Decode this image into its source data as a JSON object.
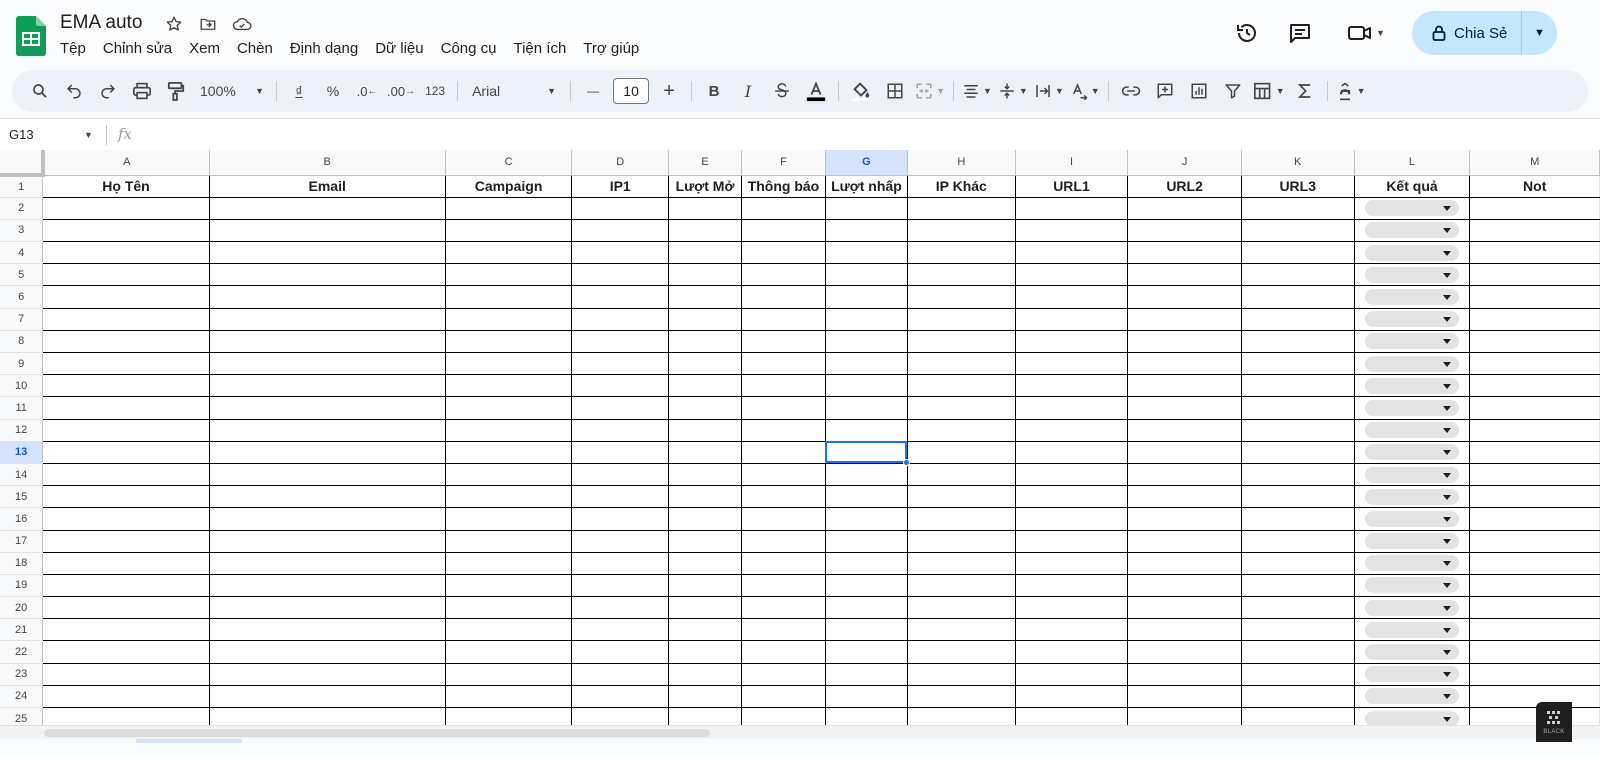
{
  "doc": {
    "title": "EMA auto"
  },
  "menu": [
    "Tệp",
    "Chỉnh sửa",
    "Xem",
    "Chèn",
    "Định dạng",
    "Dữ liệu",
    "Công cụ",
    "Tiện ích",
    "Trợ giúp"
  ],
  "share": {
    "label": "Chia Sẻ"
  },
  "toolbar": {
    "zoom": "100%",
    "currency": "₫",
    "percent": "%",
    "dec_decrease": ".0",
    "dec_increase": ".00",
    "number_format": "123",
    "font": "Arial",
    "font_size": "10",
    "minus": "—",
    "plus": "+",
    "bold": "B",
    "italic": "I"
  },
  "formula_bar": {
    "name_box": "G13",
    "fx": "fx",
    "value": ""
  },
  "sheet": {
    "columns": [
      "A",
      "B",
      "C",
      "D",
      "E",
      "F",
      "G",
      "H",
      "I",
      "J",
      "K",
      "L",
      "M"
    ],
    "active_column": "G",
    "active_row": "13",
    "headers": [
      "Họ Tên",
      "Email",
      "Campaign",
      "IP1",
      "Lượt Mở",
      "Thông báo",
      "Lượt nhấp",
      "IP Khác",
      "URL1",
      "URL2",
      "URL3",
      "Kết quả",
      "Not"
    ],
    "rows": [
      "1",
      "2",
      "3",
      "4",
      "5",
      "6",
      "7",
      "8",
      "9",
      "10",
      "11",
      "12",
      "13",
      "14",
      "15",
      "16",
      "17",
      "18",
      "19",
      "20",
      "21",
      "22",
      "23",
      "24",
      "25"
    ],
    "dropdown_column": "L"
  },
  "watermark": {
    "text": "BLACK"
  },
  "colors": {
    "accent": "#1a73e8",
    "share_bg": "#c2e7ff",
    "toolbar_bg": "#edf2fa",
    "sheets_green": "#0f9d58"
  }
}
